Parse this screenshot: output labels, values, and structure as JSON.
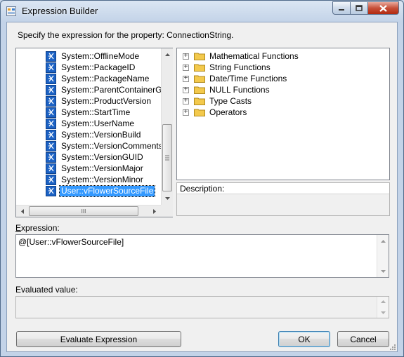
{
  "window": {
    "title": "Expression Builder",
    "accent_color": "#c3d3e8",
    "icon": "dialog-app-icon"
  },
  "caption_buttons": {
    "minimize_icon": "minimize-icon",
    "maximize_icon": "maximize-icon",
    "close_icon": "close-icon"
  },
  "prompt": "Specify the expression for the property: ConnectionString.",
  "variables": {
    "items": [
      "System::OfflineMode",
      "System::PackageID",
      "System::PackageName",
      "System::ParentContainerGUID",
      "System::ProductVersion",
      "System::StartTime",
      "System::UserName",
      "System::VersionBuild",
      "System::VersionComments",
      "System::VersionGUID",
      "System::VersionMajor",
      "System::VersionMinor",
      "User::vFlowerSourceFile"
    ],
    "selected_index": 12,
    "hscroll_grip": "III",
    "selection_color": "#3399ff"
  },
  "functions": {
    "items": [
      "Mathematical Functions",
      "String Functions",
      "Date/Time Functions",
      "NULL Functions",
      "Type Casts",
      "Operators"
    ],
    "expander_symbol": "+"
  },
  "description": {
    "label": "Description:",
    "value": ""
  },
  "expression": {
    "label": "Expression:",
    "value": "@[User::vFlowerSourceFile]"
  },
  "evaluated": {
    "label": "Evaluated value:",
    "value": ""
  },
  "buttons": {
    "evaluate": "Evaluate Expression",
    "ok": "OK",
    "cancel": "Cancel"
  }
}
